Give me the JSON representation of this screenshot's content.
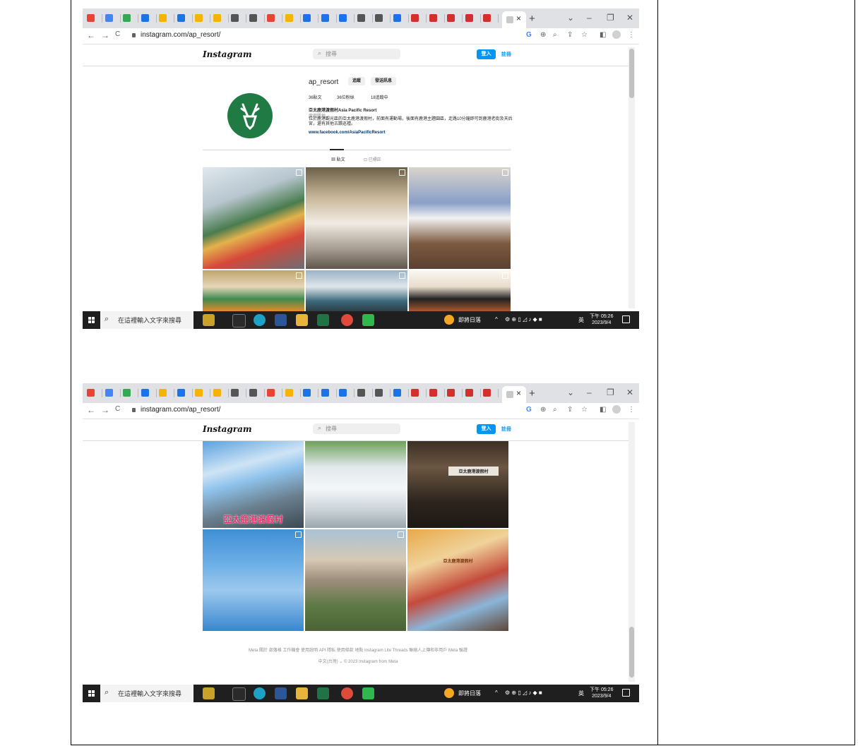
{
  "browser": {
    "url": "instagram.com/ap_resort/",
    "tab_favicons": [
      "#ea4335",
      "#4285f4",
      "#34a853",
      "#1a73e8",
      "#f4b400",
      "#1a73e8",
      "#f4b400",
      "#f4b400",
      "#555555",
      "#555555",
      "#ea4335",
      "#f4b400",
      "#1a73e8",
      "#1a73e8",
      "#1a73e8",
      "#555555",
      "#555555",
      "#1a73e8",
      "#d32f2f",
      "#d32f2f",
      "#d32f2f",
      "#d32f2f",
      "#d32f2f"
    ],
    "close_glyph": "×",
    "new_tab_glyph": "+",
    "chevron_glyph": "⌄",
    "minimize_glyph": "–",
    "restore_glyph": "❐",
    "window_close_glyph": "✕",
    "back_glyph": "←",
    "forward_glyph": "→",
    "reload_glyph": "C",
    "google_glyph": "G",
    "zoom_glyph": "⌕",
    "share_glyph": "⇪",
    "star_glyph": "☆",
    "menu_glyph": "⋮"
  },
  "instagram": {
    "logo": "Instagram",
    "search_placeholder": "搜尋",
    "login": "登入",
    "signup": "註冊",
    "profile": {
      "username": "ap_resort",
      "follow": "追蹤",
      "message": "發送訊息",
      "posts": "36貼文",
      "followers": "36位粉絲",
      "following": "18追蹤中",
      "name": "亞太鹿港渡假村Asia Pacific Resort",
      "category": "度假勝地",
      "bio": "位於鹿港觀光區的亞太鹿港渡假村，前面有運動場，後面有鹿港主題園區，走路10分鐘即可到鹿港老街及天后宮，還有其他古蹟巡禮。",
      "link": "www.facebook.com/AsiaPacificResort"
    },
    "tabs": {
      "posts": "貼文",
      "tagged": "已標註"
    },
    "photo_overlay_1": "亞太鹿港渡假村",
    "photo_overlay_2": "亞太鹿港渡假村",
    "photo_overlay_3": "亞太鹿港渡假村",
    "footer_links": "Meta   關於   部落格   工作機會   使用說明   API   隱私   使用條款   地點   Instagram Lite   Threads   聯絡人上傳和非用戶   Meta 驗證",
    "footer_copy": "中文(台灣) ⌄    © 2023 Instagram from Meta"
  },
  "taskbar": {
    "search_text": "在這裡輸入文字來搜尋",
    "weather": "即將日落",
    "ime": "英",
    "time": "下午 05:26",
    "date": "2023/9/4"
  }
}
